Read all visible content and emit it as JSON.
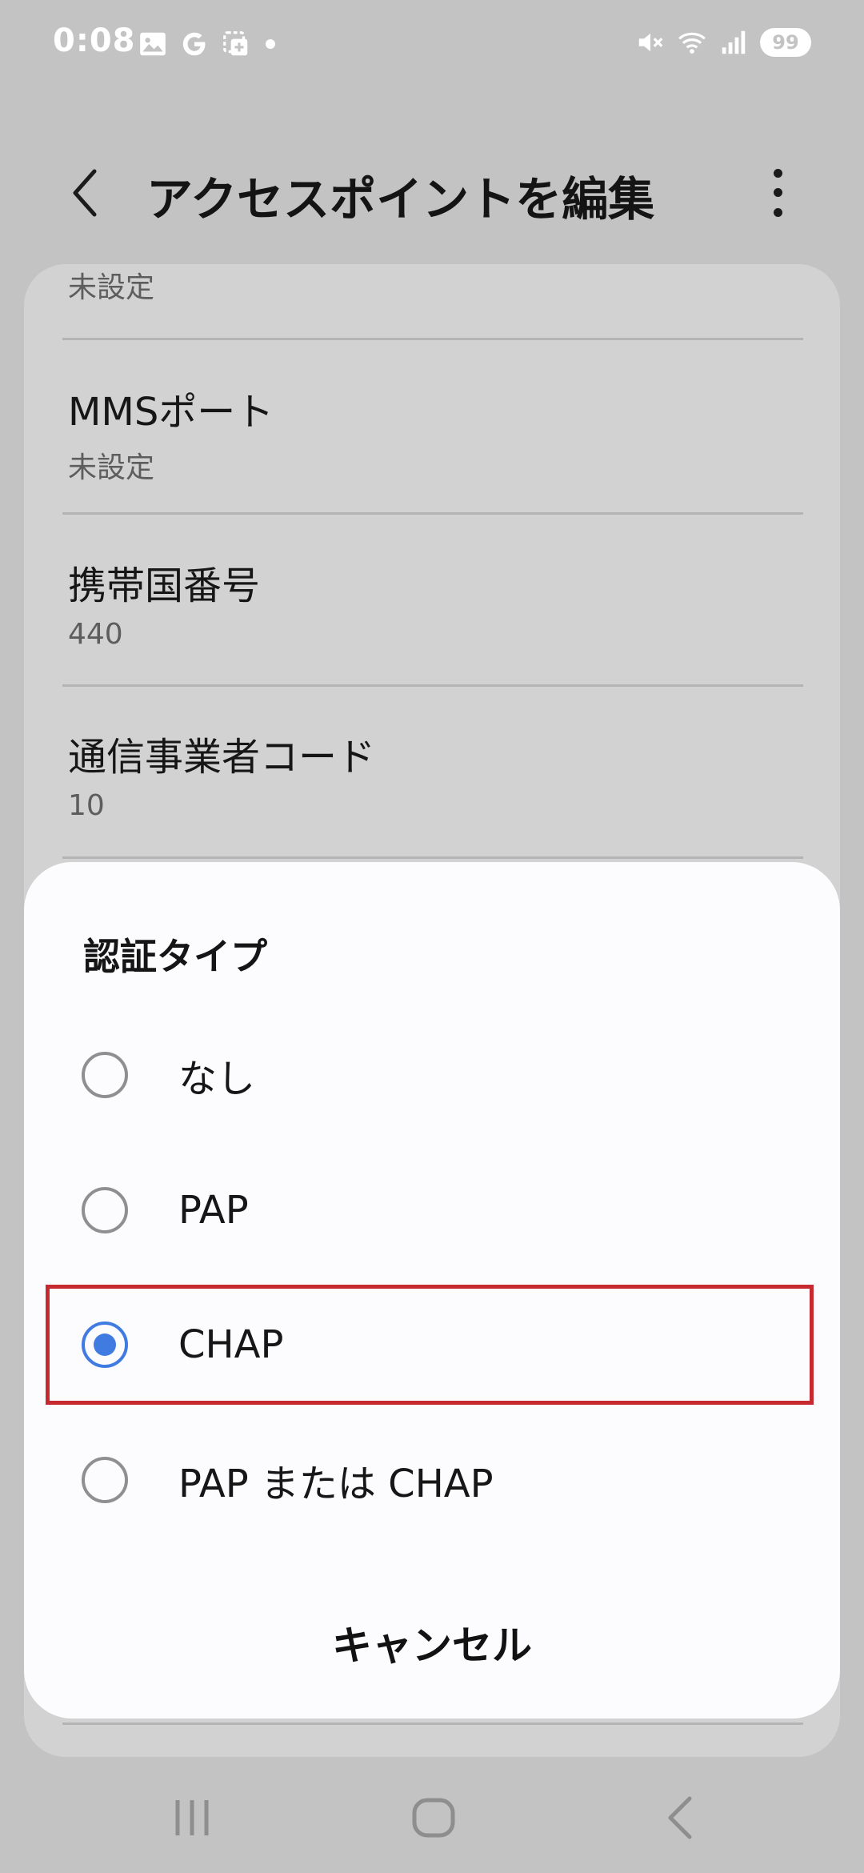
{
  "status_bar": {
    "time": "0:08",
    "battery": "99",
    "left_icons": [
      "image-icon",
      "google-icon",
      "screenshot-icon"
    ],
    "right_icons": [
      "mute-icon",
      "wifi-icon",
      "signal-icon"
    ]
  },
  "header": {
    "title": "アクセスポイントを編集"
  },
  "settings": [
    {
      "title": "",
      "value": "未設定"
    },
    {
      "title": "MMSポート",
      "value": "未設定"
    },
    {
      "title": "携帯国番号",
      "value": "440"
    },
    {
      "title": "通信事業者コード",
      "value": "10"
    }
  ],
  "dialog": {
    "title": "認証タイプ",
    "options": [
      {
        "label": "なし",
        "selected": false
      },
      {
        "label": "PAP",
        "selected": false
      },
      {
        "label": "CHAP",
        "selected": true
      },
      {
        "label": "PAP または CHAP",
        "selected": false
      }
    ],
    "cancel_label": "キャンセル"
  },
  "colors": {
    "accent": "#3f7be0",
    "highlight_border": "#c62a2f",
    "scrim_background": "#c3c3c4"
  }
}
